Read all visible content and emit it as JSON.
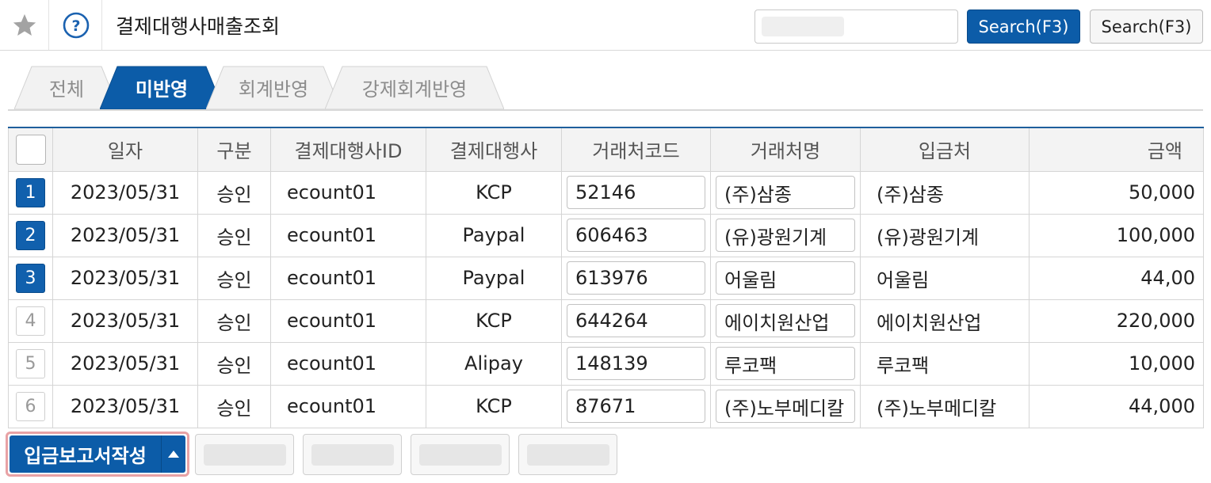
{
  "header": {
    "title": "결제대행사매출조회",
    "search_placeholder": "",
    "search_button": "Search(F3)",
    "search_button_secondary": "Search(F3)"
  },
  "tabs": [
    {
      "label": "전체",
      "active": false
    },
    {
      "label": "미반영",
      "active": true
    },
    {
      "label": "회계반영",
      "active": false
    },
    {
      "label": "강제회계반영",
      "active": false
    }
  ],
  "grid": {
    "columns": [
      "일자",
      "구분",
      "결제대행사ID",
      "결제대행사",
      "거래처코드",
      "거래처명",
      "입금처",
      "금액"
    ],
    "rows": [
      {
        "no": "1",
        "selected": true,
        "date": "2023/05/31",
        "type": "승인",
        "id": "ecount01",
        "agent": "KCP",
        "code": "52146",
        "name": "(주)삼종",
        "deposit": "(주)삼종",
        "amount": "50,000"
      },
      {
        "no": "2",
        "selected": true,
        "date": "2023/05/31",
        "type": "승인",
        "id": "ecount01",
        "agent": "Paypal",
        "code": "606463",
        "name": "(유)광원기계",
        "deposit": "(유)광원기계",
        "amount": "100,000"
      },
      {
        "no": "3",
        "selected": true,
        "date": "2023/05/31",
        "type": "승인",
        "id": "ecount01",
        "agent": "Paypal",
        "code": "613976",
        "name": "어울림",
        "deposit": "어울림",
        "amount": "44,00"
      },
      {
        "no": "4",
        "selected": false,
        "date": "2023/05/31",
        "type": "승인",
        "id": "ecount01",
        "agent": "KCP",
        "code": "644264",
        "name": "에이치원산업",
        "deposit": "에이치원산업",
        "amount": "220,000"
      },
      {
        "no": "5",
        "selected": false,
        "date": "2023/05/31",
        "type": "승인",
        "id": "ecount01",
        "agent": "Alipay",
        "code": "148139",
        "name": "루코팩",
        "deposit": "루코팩",
        "amount": "10,000"
      },
      {
        "no": "6",
        "selected": false,
        "date": "2023/05/31",
        "type": "승인",
        "id": "ecount01",
        "agent": "KCP",
        "code": "87671",
        "name": "(주)노부메디칼",
        "deposit": "(주)노부메디칼",
        "amount": "44,000"
      }
    ]
  },
  "footer": {
    "main_button": "입금보고서작성"
  },
  "colors": {
    "accent": "#0c5ca8",
    "tab_inactive": "#f2f2f2",
    "highlight_border": "#e8a2a5"
  }
}
